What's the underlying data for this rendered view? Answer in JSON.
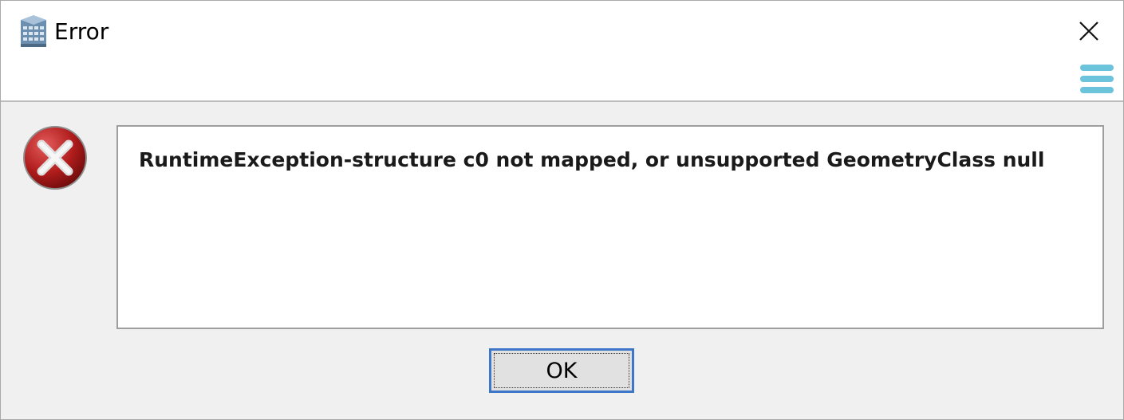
{
  "dialog": {
    "title": "Error",
    "app_icon": "app-database-icon",
    "close_icon": "close-icon",
    "menu_icon": "hamburger-menu-icon",
    "error_icon": "error-x-icon",
    "message": "RuntimeException-structure c0 not mapped, or unsupported GeometryClass null",
    "ok_label": "OK"
  },
  "colors": {
    "accent": "#3e76c8",
    "menu_icon": "#6bc3dc",
    "error_red": "#b01c1c",
    "window_bg": "#f0f0f0"
  }
}
